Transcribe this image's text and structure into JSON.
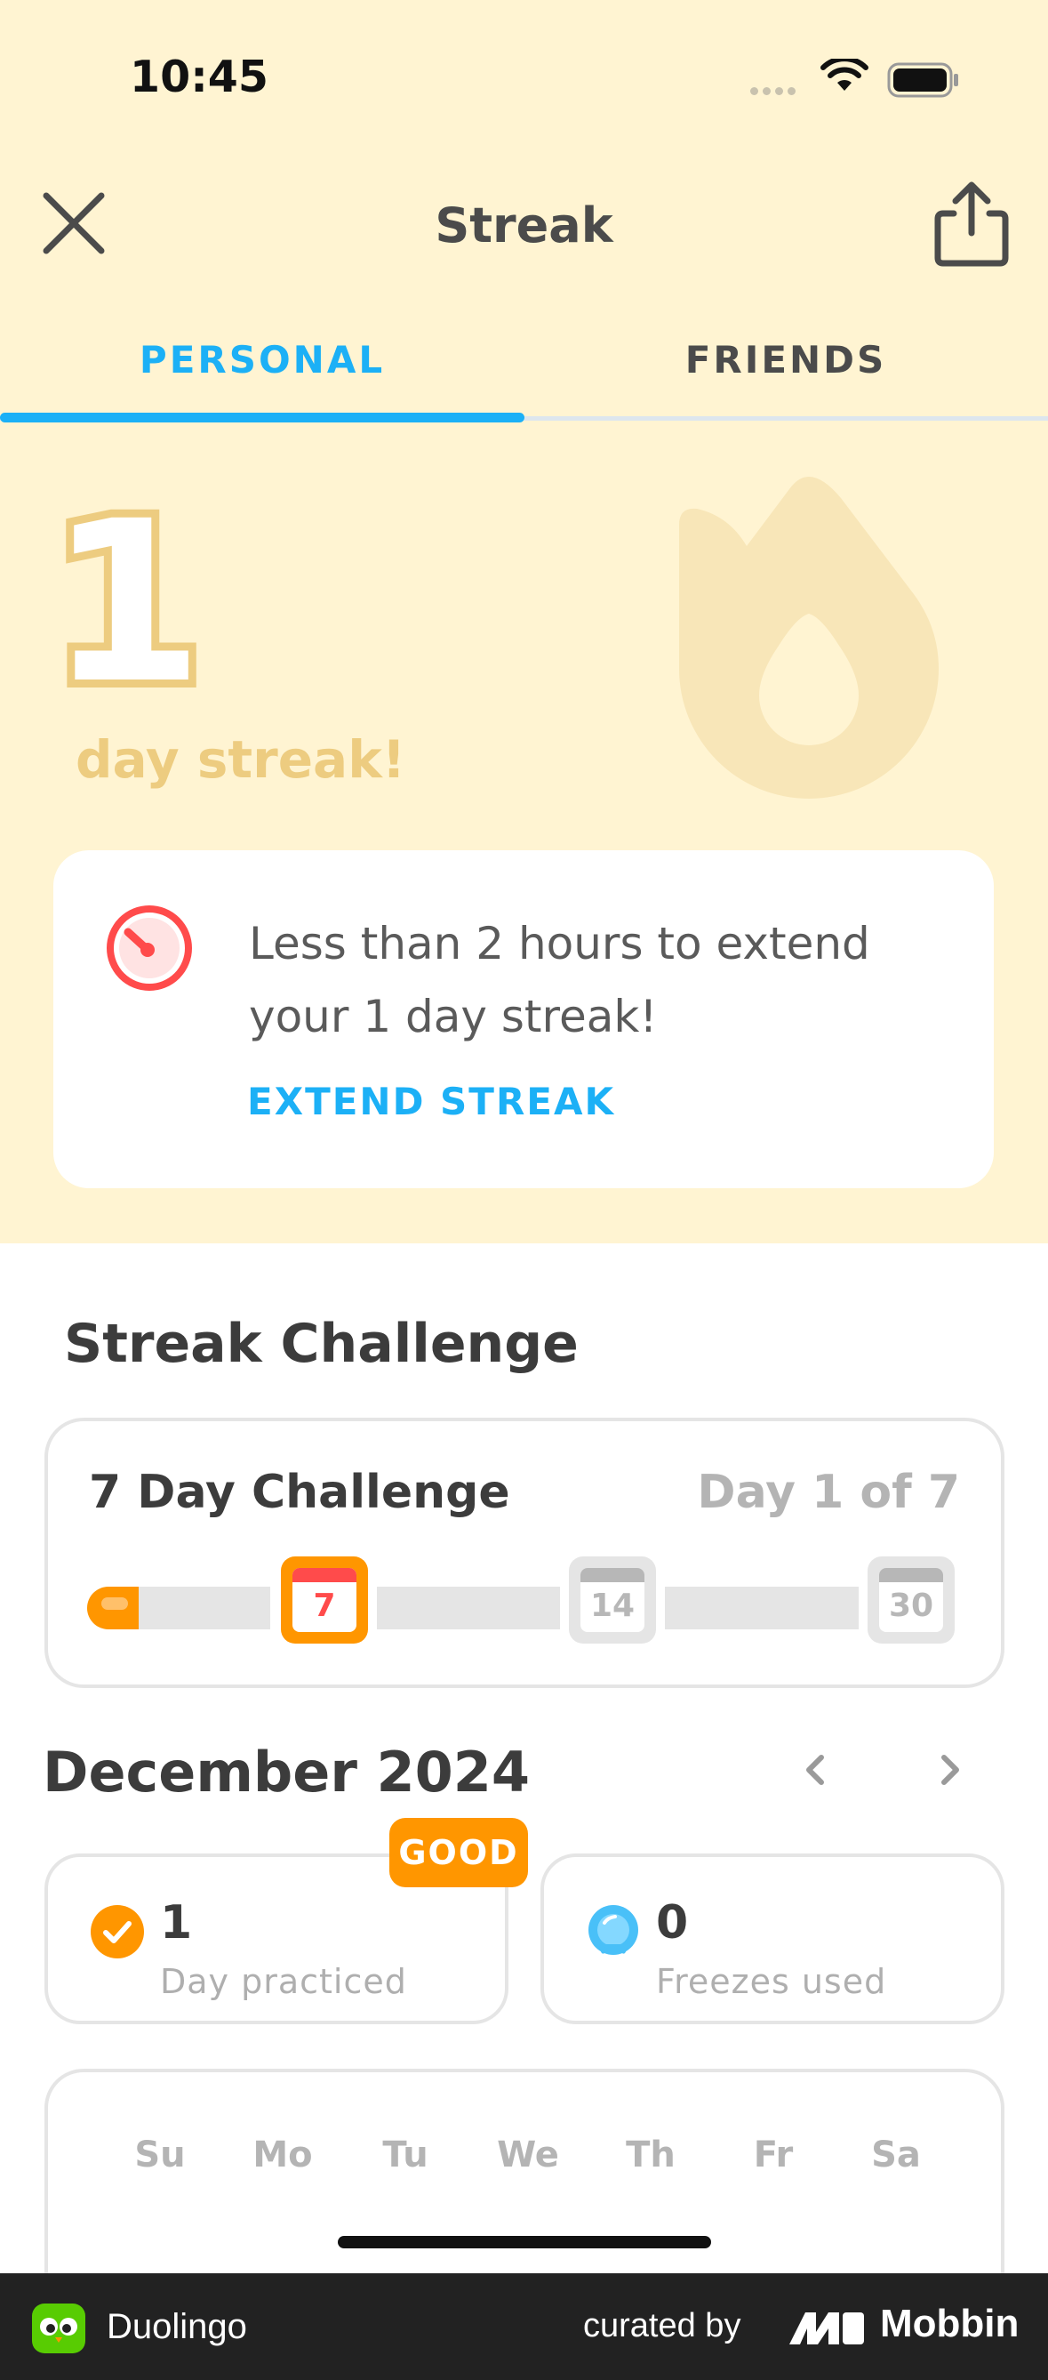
{
  "status_bar": {
    "time": "10:45"
  },
  "header": {
    "title": "Streak"
  },
  "tabs": [
    {
      "label": "PERSONAL",
      "active": true
    },
    {
      "label": "FRIENDS",
      "active": false
    }
  ],
  "streak": {
    "count": "1",
    "label": "day streak!"
  },
  "reminder": {
    "text": "Less than 2 hours to extend your 1 day streak!",
    "action_label": "EXTEND STREAK"
  },
  "challenge_section": {
    "title": "Streak Challenge",
    "name": "7 Day Challenge",
    "progress_text": "Day 1 of 7",
    "milestones": [
      "7",
      "14",
      "30"
    ],
    "progress_fraction": 0.14
  },
  "calendar": {
    "month": "December 2024",
    "good_badge": "GOOD",
    "practiced": {
      "value": "1",
      "label": "Day practiced"
    },
    "freezes": {
      "value": "0",
      "label": "Freezes used"
    },
    "weekdays": [
      "Su",
      "Mo",
      "Tu",
      "We",
      "Th",
      "Fr",
      "Sa"
    ]
  },
  "footer": {
    "app_name": "Duolingo",
    "curated_by": "curated by",
    "brand": "Mobbin"
  },
  "colors": {
    "background_top": "#fff4d2",
    "accent_blue": "#1cb0f6",
    "accent_orange": "#ff9600",
    "streak_gold": "#edcc80",
    "alert_red": "#ff4b4b"
  }
}
